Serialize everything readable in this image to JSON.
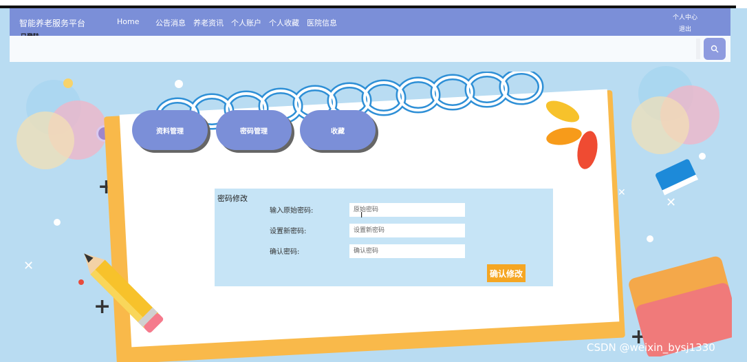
{
  "navbar": {
    "brand": "智能养老服务平台",
    "home": "Home",
    "links": [
      "公告消息",
      "养老资讯",
      "个人账户",
      "个人收藏",
      "医院信息"
    ],
    "personal_center": "个人中心",
    "logout": "退出"
  },
  "login_label": "已登陆",
  "search": {
    "icon": "search-icon"
  },
  "tabs": [
    "资料管理",
    "密码管理",
    "收藏"
  ],
  "form": {
    "title": "密码修改",
    "fields": [
      {
        "label": "输入原始密码:",
        "placeholder": "原始密码"
      },
      {
        "label": "设置新密码:",
        "placeholder": "设置新密码"
      },
      {
        "label": "确认密码:",
        "placeholder": "确认密码"
      }
    ],
    "submit": "确认修改"
  },
  "watermark": "CSDN @weixin_bysj1330",
  "colors": {
    "navbar": "#7b8fd8",
    "background": "#b9dcf2",
    "form_panel": "#c6e4f6",
    "submit_button": "#f5a623",
    "paper_frame": "#f9b94a"
  }
}
